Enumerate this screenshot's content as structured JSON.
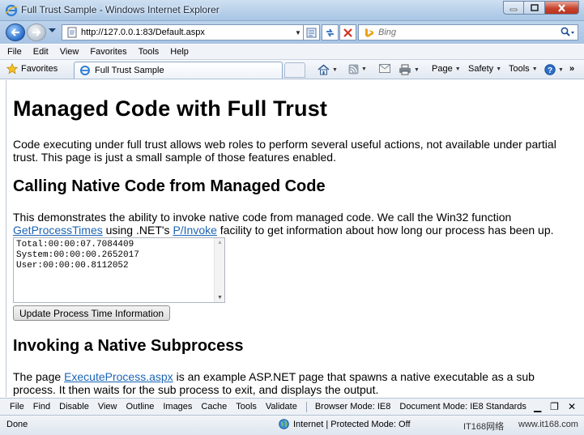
{
  "window": {
    "title": "Full Trust Sample - Windows Internet Explorer"
  },
  "address": {
    "url": "http://127.0.0.1:83/Default.aspx"
  },
  "search": {
    "placeholder": "Bing"
  },
  "menu": [
    "File",
    "Edit",
    "View",
    "Favorites",
    "Tools",
    "Help"
  ],
  "favbar": {
    "favorites_label": "Favorites",
    "tab_title": "Full Trust Sample",
    "commands": {
      "page": "Page",
      "safety": "Safety",
      "tools": "Tools"
    }
  },
  "page": {
    "h1": "Managed Code with Full Trust",
    "intro": "Code executing under full trust allows web roles to perform several useful actions, not available under partial trust. This page is just a small sample of those features enabled.",
    "section1": {
      "heading": "Calling Native Code from Managed Code",
      "text_before": "This demonstrates the ability to invoke native code from managed code. We call the Win32 function ",
      "link1": "GetProcessTimes",
      "text_middle": " using .NET's ",
      "link2": "P/Invoke",
      "text_after": " facility to get information about how long our process has been up.",
      "times_output": "Total:00:00:07.7084409\nSystem:00:00:00.2652017\nUser:00:00:00.8112052",
      "button": "Update Process Time Information"
    },
    "section2": {
      "heading": "Invoking a Native Subprocess",
      "text_before": "The page ",
      "link": "ExecuteProcess.aspx",
      "text_after": " is an example ASP.NET page that spawns a native executable as a sub process. It then waits for the sub process to exit, and displays the output."
    }
  },
  "devtools": {
    "items": [
      "File",
      "Find",
      "Disable",
      "View",
      "Outline",
      "Images",
      "Cache",
      "Tools",
      "Validate"
    ],
    "browser_mode": "Browser Mode: IE8",
    "document_mode": "Document Mode: IE8 Standards"
  },
  "status": {
    "text": "Done",
    "zone": "Internet | Protected Mode: Off",
    "watermark1": "IT168网络",
    "watermark2": "www.it168.com"
  },
  "colors": {
    "link": "#1a64b5",
    "chrome": "#b9d1ea"
  }
}
